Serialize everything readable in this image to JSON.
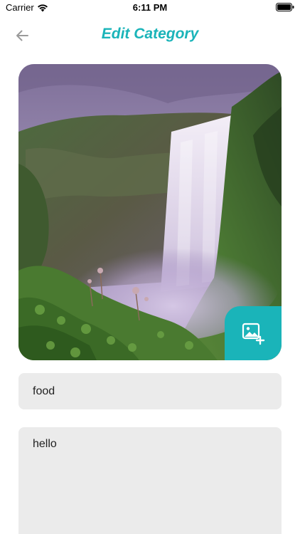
{
  "status_bar": {
    "carrier": "Carrier",
    "time": "6:11 PM",
    "icons": [
      "wifi-icon",
      "battery-icon"
    ]
  },
  "header": {
    "title": "Edit Category",
    "back_icon": "arrow-left-icon"
  },
  "image_card": {
    "subject": "waterfall-photo",
    "add_image_icon": "add-photo-icon"
  },
  "form": {
    "name_value": "food",
    "description_value": "hello"
  },
  "colors": {
    "accent": "#1ab4b9",
    "field_background": "#ebebeb"
  }
}
